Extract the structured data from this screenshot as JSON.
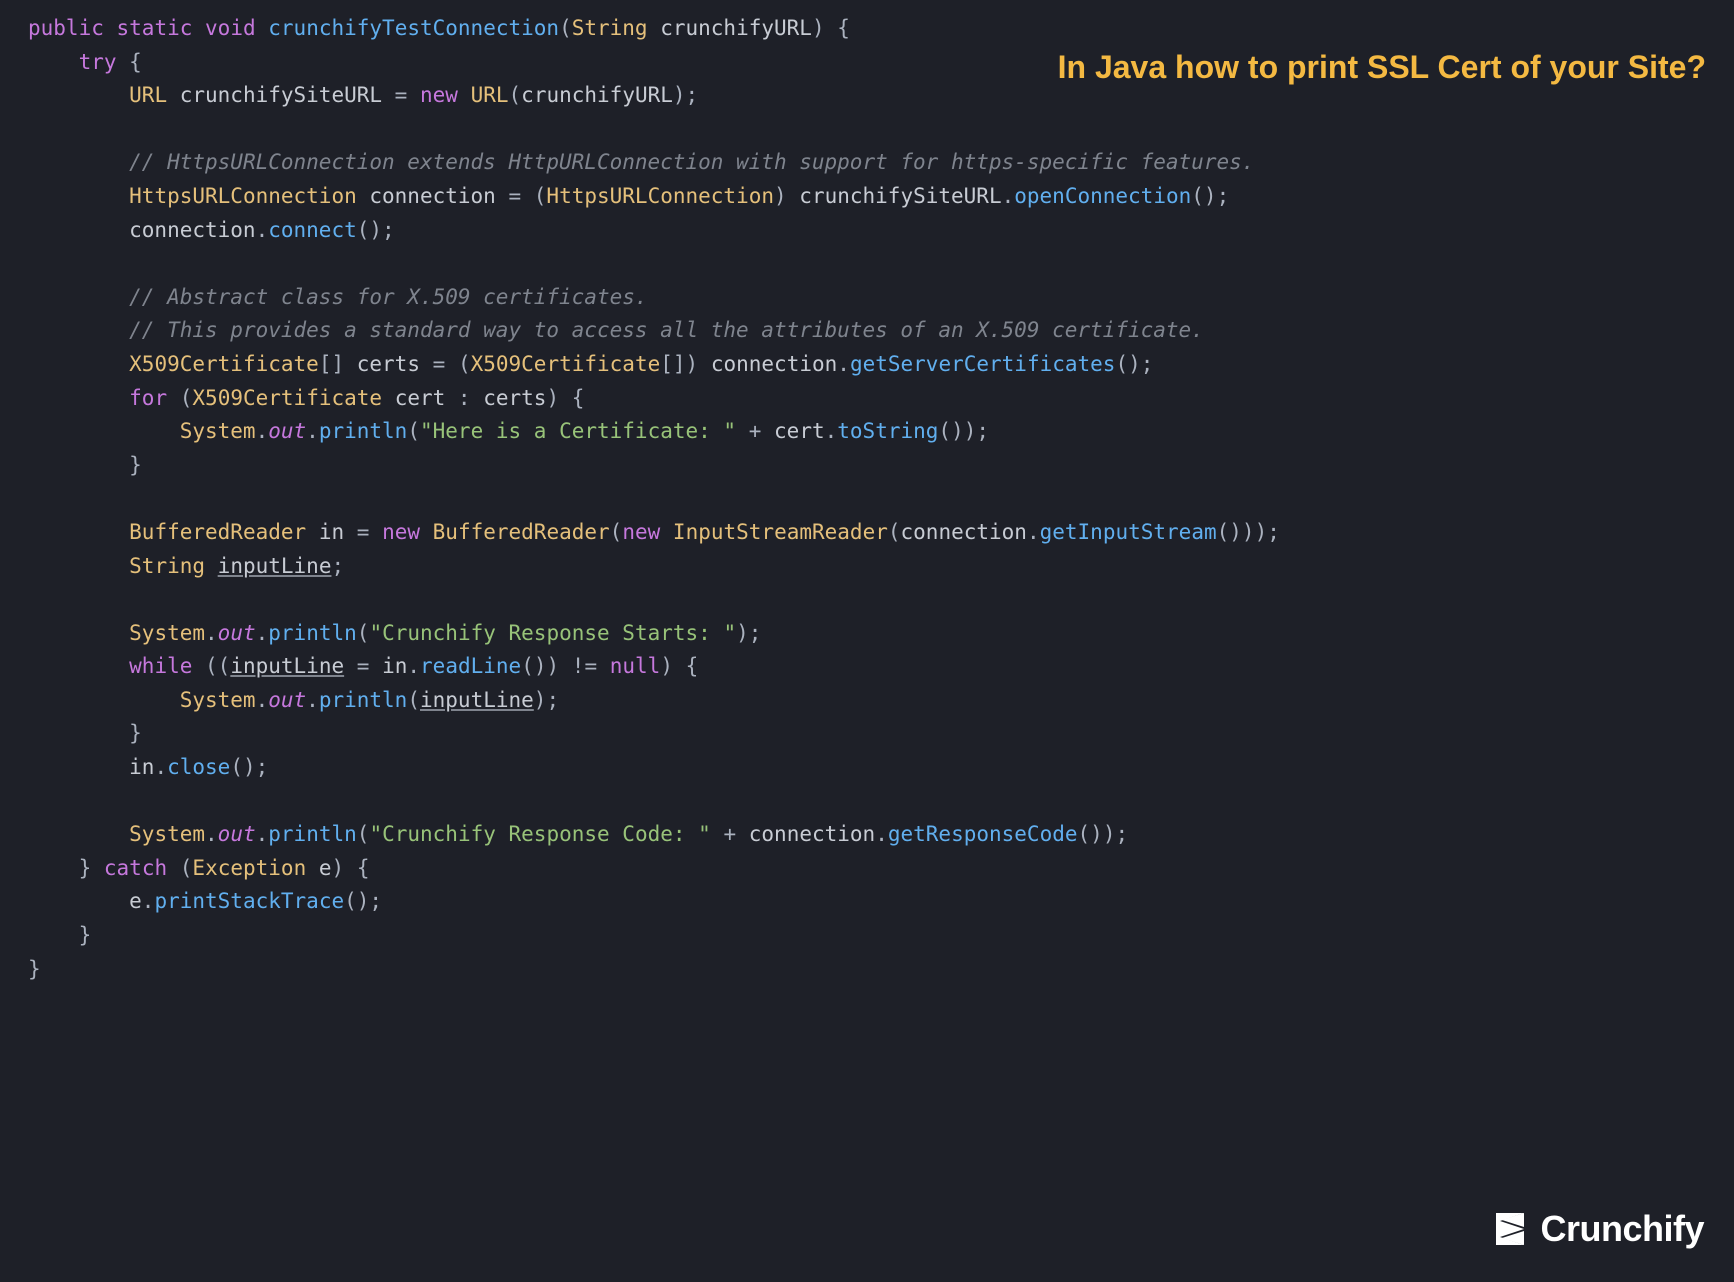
{
  "title": "In Java how to print SSL Cert of your Site?",
  "logo": "Crunchify",
  "code": {
    "tokens": [
      [
        [
          "kw",
          "public"
        ],
        [
          "plain",
          " "
        ],
        [
          "kw",
          "static"
        ],
        [
          "plain",
          " "
        ],
        [
          "kw",
          "void"
        ],
        [
          "plain",
          " "
        ],
        [
          "method",
          "crunchifyTestConnection"
        ],
        [
          "paren",
          "("
        ],
        [
          "type",
          "String"
        ],
        [
          "plain",
          " crunchifyURL"
        ],
        [
          "paren",
          ")"
        ],
        [
          "plain",
          " "
        ],
        [
          "punct",
          "{"
        ]
      ],
      [
        [
          "plain",
          "    "
        ],
        [
          "kw",
          "try"
        ],
        [
          "plain",
          " "
        ],
        [
          "punct",
          "{"
        ]
      ],
      [
        [
          "plain",
          "        "
        ],
        [
          "type",
          "URL"
        ],
        [
          "plain",
          " crunchifySiteURL "
        ],
        [
          "punct",
          "="
        ],
        [
          "plain",
          " "
        ],
        [
          "kw",
          "new"
        ],
        [
          "plain",
          " "
        ],
        [
          "type",
          "URL"
        ],
        [
          "paren",
          "("
        ],
        [
          "plain",
          "crunchifyURL"
        ],
        [
          "paren",
          ")"
        ],
        [
          "punct",
          ";"
        ]
      ],
      [
        [
          "plain",
          ""
        ]
      ],
      [
        [
          "plain",
          "        "
        ],
        [
          "comment",
          "// HttpsURLConnection extends HttpURLConnection with support for https-specific features."
        ]
      ],
      [
        [
          "plain",
          "        "
        ],
        [
          "type",
          "HttpsURLConnection"
        ],
        [
          "plain",
          " connection "
        ],
        [
          "punct",
          "="
        ],
        [
          "plain",
          " "
        ],
        [
          "paren",
          "("
        ],
        [
          "type",
          "HttpsURLConnection"
        ],
        [
          "paren",
          ")"
        ],
        [
          "plain",
          " crunchifySiteURL"
        ],
        [
          "punct",
          "."
        ],
        [
          "method",
          "openConnection"
        ],
        [
          "paren",
          "()"
        ],
        [
          "punct",
          ";"
        ]
      ],
      [
        [
          "plain",
          "        connection"
        ],
        [
          "punct",
          "."
        ],
        [
          "method",
          "connect"
        ],
        [
          "paren",
          "()"
        ],
        [
          "punct",
          ";"
        ]
      ],
      [
        [
          "plain",
          ""
        ]
      ],
      [
        [
          "plain",
          "        "
        ],
        [
          "comment",
          "// Abstract class for X.509 certificates."
        ]
      ],
      [
        [
          "plain",
          "        "
        ],
        [
          "comment",
          "// This provides a standard way to access all the attributes of an X.509 certificate."
        ]
      ],
      [
        [
          "plain",
          "        "
        ],
        [
          "type",
          "X509Certificate"
        ],
        [
          "punct",
          "[]"
        ],
        [
          "plain",
          " certs "
        ],
        [
          "punct",
          "="
        ],
        [
          "plain",
          " "
        ],
        [
          "paren",
          "("
        ],
        [
          "type",
          "X509Certificate"
        ],
        [
          "punct",
          "[]"
        ],
        [
          "paren",
          ")"
        ],
        [
          "plain",
          " connection"
        ],
        [
          "punct",
          "."
        ],
        [
          "method",
          "getServerCertificates"
        ],
        [
          "paren",
          "()"
        ],
        [
          "punct",
          ";"
        ]
      ],
      [
        [
          "plain",
          "        "
        ],
        [
          "kw",
          "for"
        ],
        [
          "plain",
          " "
        ],
        [
          "paren",
          "("
        ],
        [
          "type",
          "X509Certificate"
        ],
        [
          "plain",
          " cert "
        ],
        [
          "punct",
          ":"
        ],
        [
          "plain",
          " certs"
        ],
        [
          "paren",
          ")"
        ],
        [
          "plain",
          " "
        ],
        [
          "punct",
          "{"
        ]
      ],
      [
        [
          "plain",
          "            "
        ],
        [
          "type",
          "System"
        ],
        [
          "punct",
          "."
        ],
        [
          "field",
          "out"
        ],
        [
          "punct",
          "."
        ],
        [
          "method",
          "println"
        ],
        [
          "paren",
          "("
        ],
        [
          "str",
          "\"Here is a Certificate: \""
        ],
        [
          "plain",
          " "
        ],
        [
          "punct",
          "+"
        ],
        [
          "plain",
          " cert"
        ],
        [
          "punct",
          "."
        ],
        [
          "method",
          "toString"
        ],
        [
          "paren",
          "()"
        ],
        [
          "paren",
          ")"
        ],
        [
          "punct",
          ";"
        ]
      ],
      [
        [
          "plain",
          "        "
        ],
        [
          "punct",
          "}"
        ]
      ],
      [
        [
          "plain",
          ""
        ]
      ],
      [
        [
          "plain",
          "        "
        ],
        [
          "type",
          "BufferedReader"
        ],
        [
          "plain",
          " in "
        ],
        [
          "punct",
          "="
        ],
        [
          "plain",
          " "
        ],
        [
          "kw",
          "new"
        ],
        [
          "plain",
          " "
        ],
        [
          "type",
          "BufferedReader"
        ],
        [
          "paren",
          "("
        ],
        [
          "kw",
          "new"
        ],
        [
          "plain",
          " "
        ],
        [
          "type",
          "InputStreamReader"
        ],
        [
          "paren",
          "("
        ],
        [
          "plain",
          "connection"
        ],
        [
          "punct",
          "."
        ],
        [
          "method",
          "getInputStream"
        ],
        [
          "paren",
          "()"
        ],
        [
          "paren",
          ")"
        ],
        [
          "paren",
          ")"
        ],
        [
          "punct",
          ";"
        ]
      ],
      [
        [
          "plain",
          "        "
        ],
        [
          "type",
          "String"
        ],
        [
          "plain",
          " "
        ],
        [
          "underline",
          "inputLine"
        ],
        [
          "punct",
          ";"
        ]
      ],
      [
        [
          "plain",
          ""
        ]
      ],
      [
        [
          "plain",
          "        "
        ],
        [
          "type",
          "System"
        ],
        [
          "punct",
          "."
        ],
        [
          "field",
          "out"
        ],
        [
          "punct",
          "."
        ],
        [
          "method",
          "println"
        ],
        [
          "paren",
          "("
        ],
        [
          "str",
          "\"Crunchify Response Starts: \""
        ],
        [
          "paren",
          ")"
        ],
        [
          "punct",
          ";"
        ]
      ],
      [
        [
          "plain",
          "        "
        ],
        [
          "kw",
          "while"
        ],
        [
          "plain",
          " "
        ],
        [
          "paren",
          "(("
        ],
        [
          "underline",
          "inputLine"
        ],
        [
          "plain",
          " "
        ],
        [
          "punct",
          "="
        ],
        [
          "plain",
          " in"
        ],
        [
          "punct",
          "."
        ],
        [
          "method",
          "readLine"
        ],
        [
          "paren",
          "()"
        ],
        [
          "paren",
          ")"
        ],
        [
          "plain",
          " "
        ],
        [
          "punct",
          "!="
        ],
        [
          "plain",
          " "
        ],
        [
          "kw",
          "null"
        ],
        [
          "paren",
          ")"
        ],
        [
          "plain",
          " "
        ],
        [
          "punct",
          "{"
        ]
      ],
      [
        [
          "plain",
          "            "
        ],
        [
          "type",
          "System"
        ],
        [
          "punct",
          "."
        ],
        [
          "field",
          "out"
        ],
        [
          "punct",
          "."
        ],
        [
          "method",
          "println"
        ],
        [
          "paren",
          "("
        ],
        [
          "underline",
          "inputLine"
        ],
        [
          "paren",
          ")"
        ],
        [
          "punct",
          ";"
        ]
      ],
      [
        [
          "plain",
          "        "
        ],
        [
          "punct",
          "}"
        ]
      ],
      [
        [
          "plain",
          "        in"
        ],
        [
          "punct",
          "."
        ],
        [
          "method",
          "close"
        ],
        [
          "paren",
          "()"
        ],
        [
          "punct",
          ";"
        ]
      ],
      [
        [
          "plain",
          ""
        ]
      ],
      [
        [
          "plain",
          "        "
        ],
        [
          "type",
          "System"
        ],
        [
          "punct",
          "."
        ],
        [
          "field",
          "out"
        ],
        [
          "punct",
          "."
        ],
        [
          "method",
          "println"
        ],
        [
          "paren",
          "("
        ],
        [
          "str",
          "\"Crunchify Response Code: \""
        ],
        [
          "plain",
          " "
        ],
        [
          "punct",
          "+"
        ],
        [
          "plain",
          " connection"
        ],
        [
          "punct",
          "."
        ],
        [
          "method",
          "getResponseCode"
        ],
        [
          "paren",
          "()"
        ],
        [
          "paren",
          ")"
        ],
        [
          "punct",
          ";"
        ]
      ],
      [
        [
          "plain",
          "    "
        ],
        [
          "punct",
          "}"
        ],
        [
          "plain",
          " "
        ],
        [
          "kw",
          "catch"
        ],
        [
          "plain",
          " "
        ],
        [
          "paren",
          "("
        ],
        [
          "type",
          "Exception"
        ],
        [
          "plain",
          " e"
        ],
        [
          "paren",
          ")"
        ],
        [
          "plain",
          " "
        ],
        [
          "punct",
          "{"
        ]
      ],
      [
        [
          "plain",
          "        e"
        ],
        [
          "punct",
          "."
        ],
        [
          "method",
          "printStackTrace"
        ],
        [
          "paren",
          "()"
        ],
        [
          "punct",
          ";"
        ]
      ],
      [
        [
          "plain",
          "    "
        ],
        [
          "punct",
          "}"
        ]
      ],
      [
        [
          "punct",
          "}"
        ]
      ]
    ]
  }
}
